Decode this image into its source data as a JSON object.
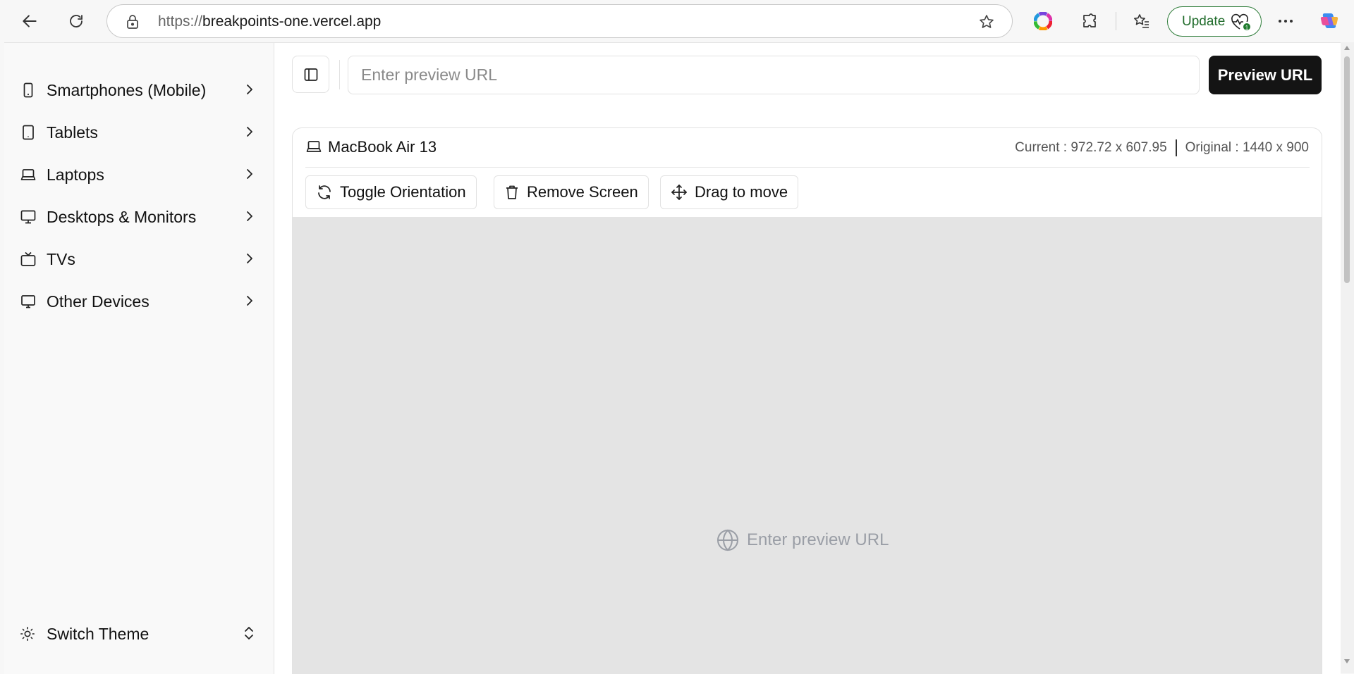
{
  "browser": {
    "url_scheme": "https://",
    "url_host": "breakpoints-one.vercel.app",
    "update_label": "Update"
  },
  "sidebar": {
    "items": [
      {
        "label": "Smartphones (Mobile)",
        "icon": "smartphone-icon"
      },
      {
        "label": "Tablets",
        "icon": "tablet-icon"
      },
      {
        "label": "Laptops",
        "icon": "laptop-icon"
      },
      {
        "label": "Desktops & Monitors",
        "icon": "monitor-icon"
      },
      {
        "label": "TVs",
        "icon": "tv-icon"
      },
      {
        "label": "Other Devices",
        "icon": "device-icon"
      }
    ],
    "theme_label": "Switch Theme"
  },
  "toolbar": {
    "url_placeholder": "Enter preview URL",
    "preview_label": "Preview URL"
  },
  "device": {
    "name": "MacBook Air 13",
    "current": "Current : 972.72 x 607.95",
    "original": "Original : 1440 x 900",
    "toggle_label": "Toggle Orientation",
    "remove_label": "Remove Screen",
    "drag_label": "Drag to move",
    "placeholder": "Enter preview URL"
  },
  "colors": {
    "accent_dark": "#141414",
    "update_green": "#2f7d3a",
    "screen_bg": "#e4e4e4"
  }
}
